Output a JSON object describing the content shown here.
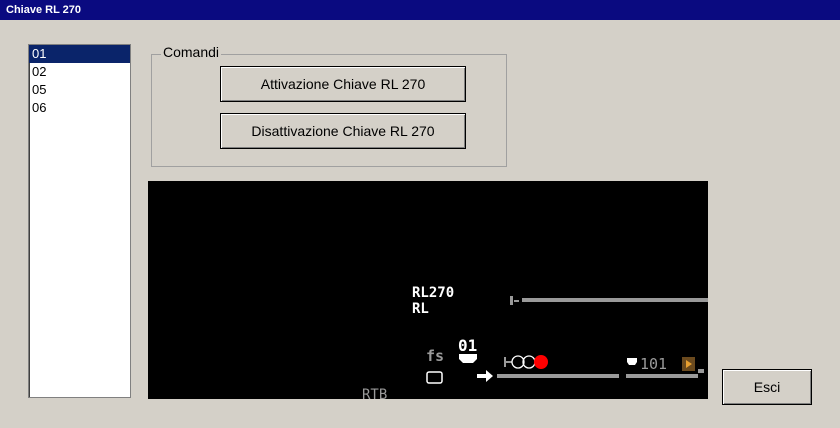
{
  "window": {
    "title": "Chiave RL 270"
  },
  "list": {
    "items": [
      "01",
      "02",
      "05",
      "06"
    ],
    "selected_index": 0
  },
  "commands": {
    "legend": "Comandi",
    "activate_label": "Attivazione Chiave RL 270",
    "deactivate_label": "Disattivazione Chiave RL 270"
  },
  "exit_label": "Esci",
  "diagram": {
    "key_name_line1": "RL270",
    "key_name_line2": "RL",
    "fs_label": "fs",
    "signal_number": "01",
    "track_number": "101",
    "rtb_label": "RTB",
    "colors": {
      "background": "#000000",
      "track": "#9a9a9a",
      "signal_red": "#ff0000",
      "text": "#ffffff"
    }
  }
}
